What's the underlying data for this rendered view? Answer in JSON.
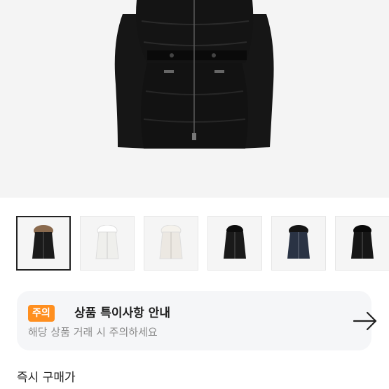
{
  "thumbnails": [
    {
      "name": "black-fur-hood",
      "color": "#1b1b1b",
      "fur": "#8a6a4e"
    },
    {
      "name": "white-fur-hood",
      "color": "#f3f3f0",
      "fur": "#ffffff"
    },
    {
      "name": "white-fur-hood-alt",
      "color": "#f0ede8",
      "fur": "#f5f2ec"
    },
    {
      "name": "black-black-fur",
      "color": "#1a1a1a",
      "fur": "#0d0d0d"
    },
    {
      "name": "navy-black-fur",
      "color": "#2a3344",
      "fur": "#151515"
    },
    {
      "name": "black-black-fur-alt",
      "color": "#161616",
      "fur": "#0a0a0a"
    }
  ],
  "notice": {
    "badge": "주의",
    "title": "상품 특이사항 안내",
    "subtitle": "해당 상품 거래 시 주의하세요"
  },
  "section": {
    "label": "즉시 구매가"
  },
  "colors": {
    "badge": "#ff8f1f",
    "card": "#f5f6f8",
    "hero_bg": "#f4f4f4"
  },
  "icons": {
    "notice_arrow": "arrow-right-icon"
  }
}
